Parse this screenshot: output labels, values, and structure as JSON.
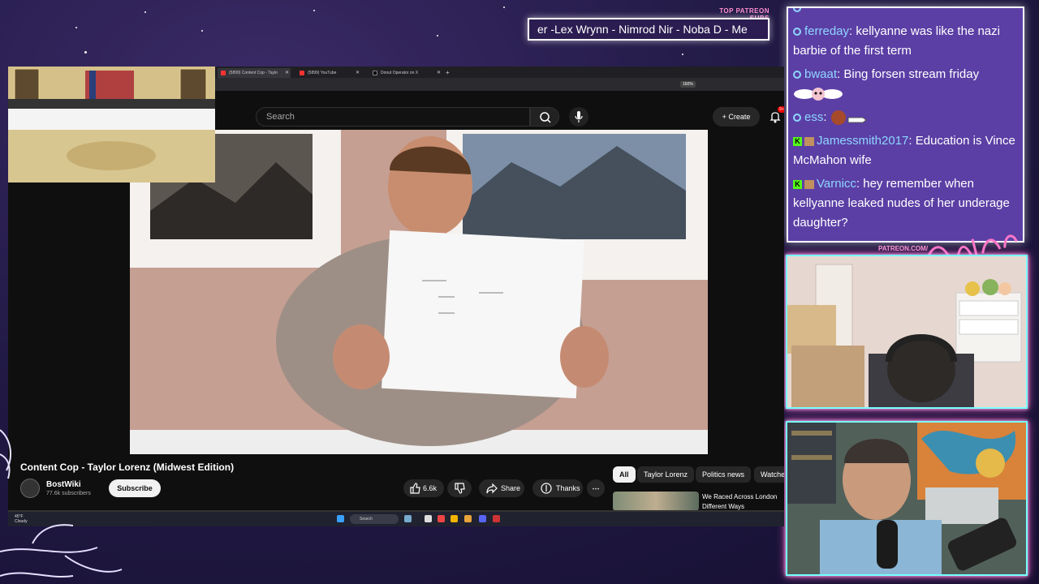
{
  "overlay": {
    "patreon_header": "TOP PATREON SUBS",
    "ticker_text": "er -Lex Wrynn - Nimrod Nir - Noba D - Me",
    "patreon_url": "PATREON.COM/",
    "logo_text": "Anything Else?"
  },
  "chat": {
    "messages": [
      {
        "user": "",
        "text": "",
        "badge": "twitch"
      },
      {
        "user": "ferreday",
        "text": "kellyanne was like the nazi barbie of the first term",
        "badge": "twitch"
      },
      {
        "user": "bwaat",
        "text": "Bing forsen stream friday",
        "badge": "twitch"
      },
      {
        "user": "ess",
        "text": "",
        "badge": "twitch"
      },
      {
        "user": "Jamessmith2017",
        "text": "Education is Vince McMahon wife",
        "badge": "kick"
      },
      {
        "user": "Varnicc",
        "text": "hey remember when kellyanne leaked nudes of her underage daughter?",
        "badge": "kick"
      }
    ]
  },
  "browser": {
    "tabs": [
      {
        "label": "(5899) Content Cop - Taylo"
      },
      {
        "label": "(5899) YouTube"
      },
      {
        "label": "Donut Operator on X"
      }
    ],
    "zoom": "160%"
  },
  "youtube": {
    "search_placeholder": "Search",
    "create_label": "Create",
    "notification_count": "9+",
    "video_title": "Content Cop - Taylor Lorenz (Midwest Edition)",
    "channel_name": "BostWiki",
    "subscribers": "77.6k subscribers",
    "subscribe_label": "Subscribe",
    "likes": "6.6k",
    "share_label": "Share",
    "thanks_label": "Thanks",
    "chips": [
      "All",
      "Taylor Lorenz",
      "Politics news",
      "Watche"
    ],
    "recommended_title": "We Raced Across London Different Ways"
  },
  "taskbar": {
    "weather_temp": "45°F",
    "weather_desc": "Cloudy",
    "search_label": "Search"
  }
}
